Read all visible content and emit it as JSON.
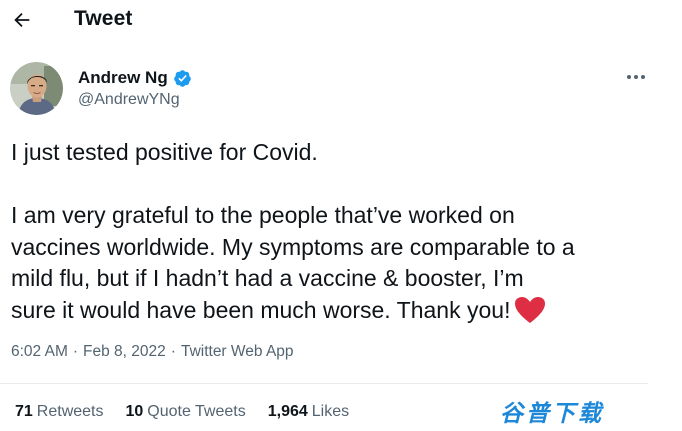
{
  "header": {
    "back_icon": "arrow-left-icon",
    "title": "Tweet"
  },
  "author": {
    "name": "Andrew Ng",
    "handle": "@AndrewYNg",
    "verified": true,
    "verified_color": "#1d9bf0",
    "avatar_icon": "user-photo-avatar",
    "more_icon": "more-horizontal-icon"
  },
  "tweet": {
    "lines": [
      "I just tested positive for Covid.",
      "",
      "I am very grateful to the people that’ve worked on",
      "vaccines worldwide. My symptoms are comparable to a",
      "mild flu, but if I hadn’t had a vaccine & booster, I’m",
      "sure it would have been much worse. Thank you!"
    ],
    "emoji": "red-heart-icon",
    "emoji_color": "#dd2e44"
  },
  "meta": {
    "time": "6:02 AM",
    "separator": "·",
    "date": "Feb 8, 2022",
    "source": "Twitter Web App"
  },
  "stats": {
    "retweets_count": "71",
    "retweets_label": "Retweets",
    "quotes_count": "10",
    "quotes_label": "Quote Tweets",
    "likes_count": "1,964",
    "likes_label": "Likes"
  },
  "watermark": {
    "text": "谷普下载",
    "color": "#1e88d8"
  },
  "colors": {
    "text_primary": "#0f1419",
    "text_secondary": "#536471",
    "divider": "#e8ecee"
  }
}
